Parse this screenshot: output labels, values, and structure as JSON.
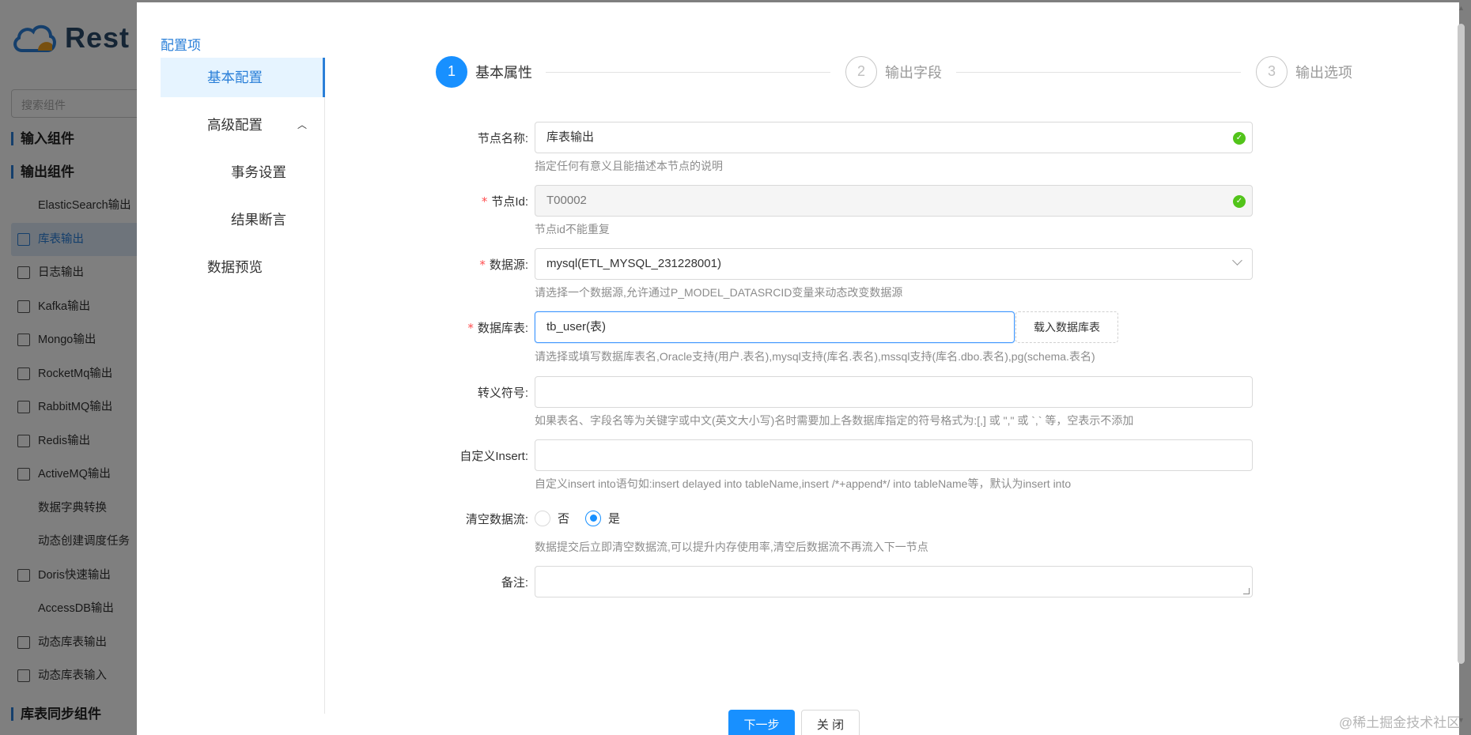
{
  "background_app": {
    "logo_text": "Rest",
    "search_placeholder": "搜索组件",
    "groups": {
      "input": "输入组件",
      "output": "输出组件",
      "sync": "库表同步组件"
    },
    "items": [
      {
        "label": "ElasticSearch输出",
        "icon": "none"
      },
      {
        "label": "库表输出",
        "icon": "table-icon",
        "active": true
      },
      {
        "label": "日志输出",
        "icon": "log-icon"
      },
      {
        "label": "Kafka输出",
        "icon": "kafka-icon"
      },
      {
        "label": "Mongo输出",
        "icon": "mongo-icon"
      },
      {
        "label": "RocketMq输出",
        "icon": "rocketmq-icon"
      },
      {
        "label": "RabbitMQ输出",
        "icon": "rabbitmq-icon"
      },
      {
        "label": "Redis输出",
        "icon": "redis-icon"
      },
      {
        "label": "ActiveMQ输出",
        "icon": "activemq-icon"
      },
      {
        "label": "数据字典转换",
        "icon": "none"
      },
      {
        "label": "动态创建调度任务",
        "icon": "none"
      },
      {
        "label": "Doris快速输出",
        "icon": "doris-icon"
      },
      {
        "label": "AccessDB输出",
        "icon": "none"
      },
      {
        "label": "动态库表输出",
        "icon": "table-icon"
      },
      {
        "label": "动态库表输入",
        "icon": "table-icon"
      }
    ]
  },
  "dialog": {
    "config_title": "配置项",
    "menu": {
      "basic": "基本配置",
      "advanced": "高级配置",
      "transaction": "事务设置",
      "assert": "结果断言",
      "preview": "数据预览"
    },
    "steps": [
      {
        "num": "1",
        "label": "基本属性",
        "active": true
      },
      {
        "num": "2",
        "label": "输出字段",
        "active": false
      },
      {
        "num": "3",
        "label": "输出选项",
        "active": false
      }
    ],
    "form": {
      "node_name": {
        "label": "节点名称:",
        "value": "库表输出",
        "help": "指定任何有意义且能描述本节点的说明"
      },
      "node_id": {
        "label": "节点Id:",
        "value": "T00002",
        "help": "节点id不能重复"
      },
      "datasource": {
        "label": "数据源:",
        "value": "mysql(ETL_MYSQL_231228001)",
        "help": "请选择一个数据源,允许通过P_MODEL_DATASRCID变量来动态改变数据源"
      },
      "table": {
        "label": "数据库表:",
        "value": "tb_user(表)",
        "button": "载入数据库表",
        "help": "请选择或填写数据库表名,Oracle支持(用户.表名),mysql支持(库名.表名),mssql支持(库名.dbo.表名),pg(schema.表名)"
      },
      "escape": {
        "label": "转义符号:",
        "value": "",
        "help": "如果表名、字段名等为关键字或中文(英文大小写)名时需要加上各数据库指定的符号格式为:[,] 或 \",\" 或 `,` 等，空表示不添加"
      },
      "custom_insert": {
        "label": "自定义Insert:",
        "value": "",
        "help": "自定义insert into语句如:insert delayed into tableName,insert /*+append*/ into tableName等，默认为insert into"
      },
      "clear_stream": {
        "label": "清空数据流:",
        "option_no": "否",
        "option_yes": "是",
        "selected": "是",
        "help": "数据提交后立即清空数据流,可以提升内存使用率,清空后数据流不再流入下一节点"
      },
      "remark": {
        "label": "备注:",
        "value": ""
      }
    },
    "buttons": {
      "next": "下一步",
      "close": "关 闭"
    }
  },
  "watermark": "@稀土掘金技术社区",
  "colors": {
    "primary": "#1890ff",
    "success": "#52c41a",
    "required": "#ff4d4f"
  }
}
